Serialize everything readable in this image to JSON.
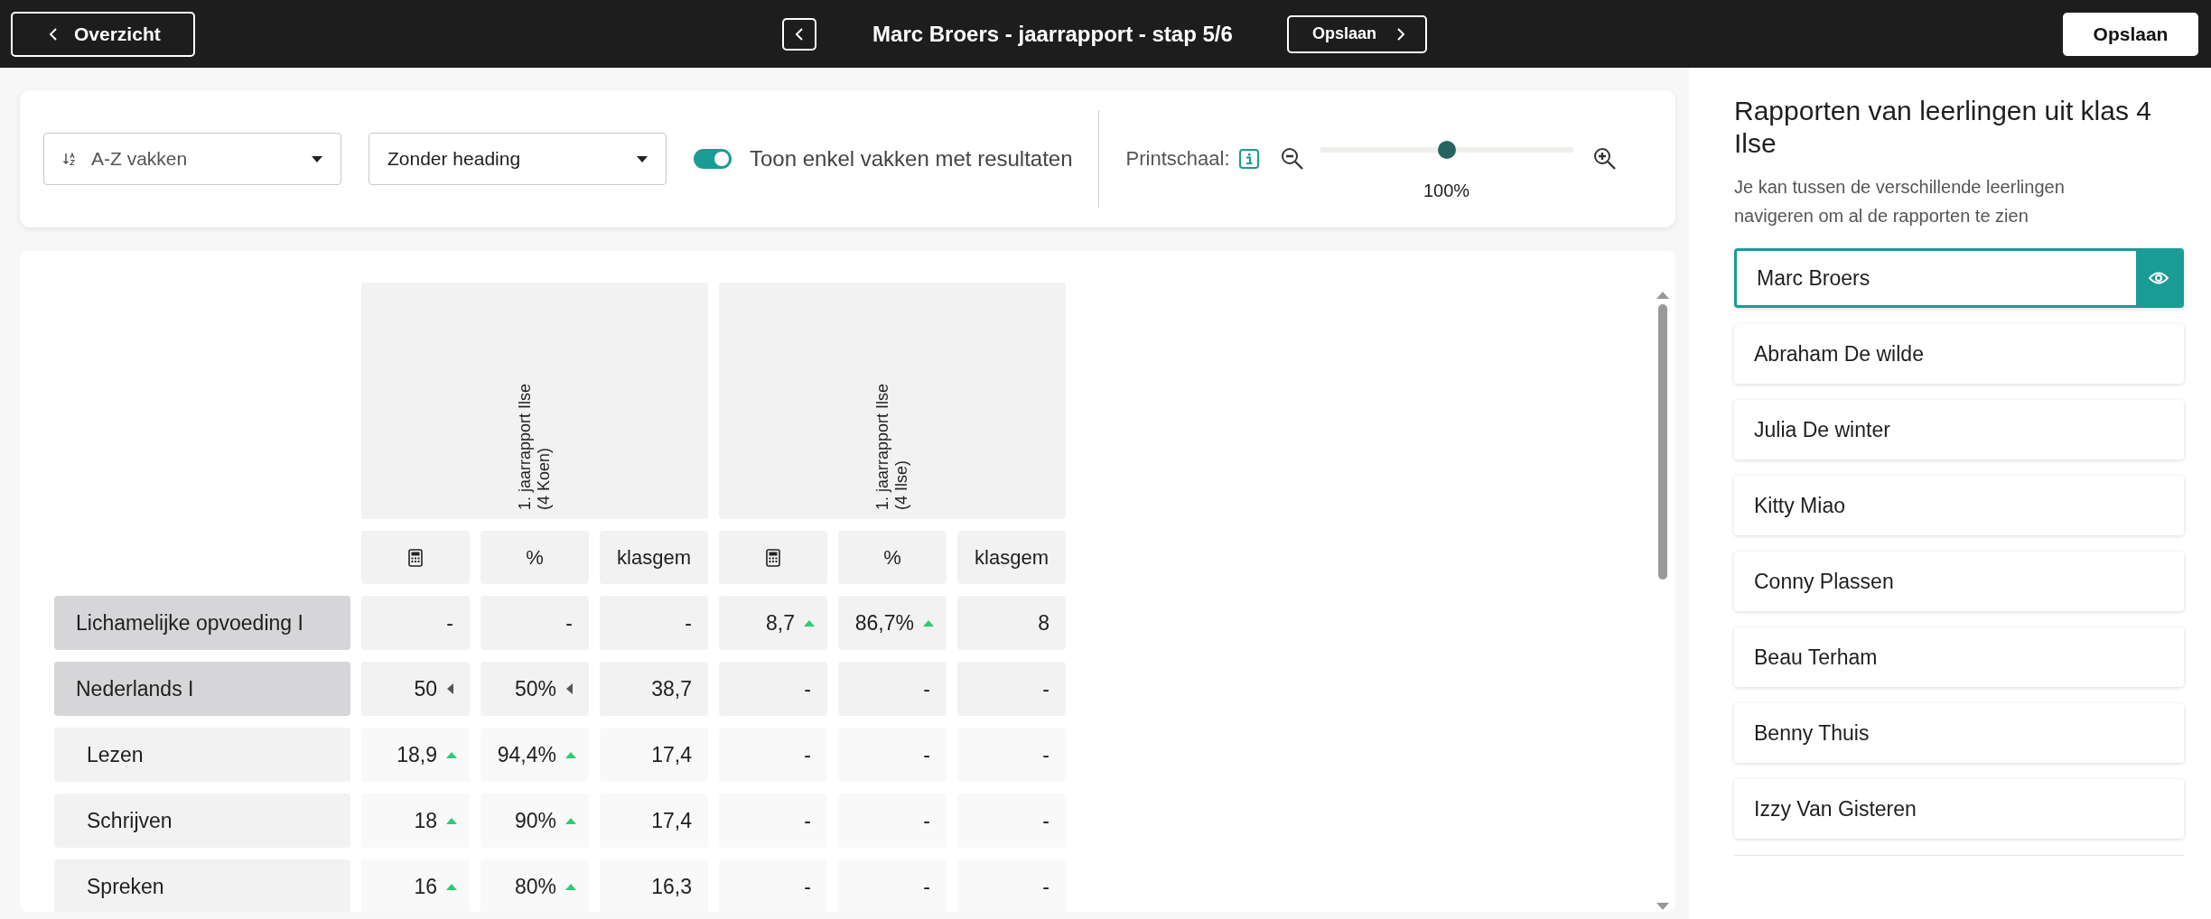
{
  "top_bar": {
    "back_button": "Overzicht",
    "title": "Marc Broers - jaarrapport - stap 5/6",
    "next_button": "Opslaan",
    "save_button": "Opslaan"
  },
  "toolbar": {
    "sort_select": "A-Z vakken",
    "heading_select": "Zonder heading",
    "toggle": {
      "label": "Toon enkel vakken met resultaten",
      "on": true
    },
    "print_scale": {
      "label": "Printschaal:",
      "level": 0.5,
      "reading": "100%"
    }
  },
  "table": {
    "groups": [
      {
        "title": "1. jaarrapport Ilse (4 Koen)",
        "columns": [
          {
            "kind": "icon"
          },
          {
            "kind": "text",
            "label": "%"
          },
          {
            "kind": "text",
            "label": "klasgem"
          }
        ]
      },
      {
        "title": "1. jaarrapport Ilse (4 Ilse)",
        "columns": [
          {
            "kind": "icon"
          },
          {
            "kind": "text",
            "label": "%"
          },
          {
            "kind": "text",
            "label": "klasgem"
          }
        ]
      }
    ],
    "rows": [
      {
        "label": "Lichamelijke opvoeding I",
        "kind": "main",
        "cells": [
          {
            "text": "-",
            "kind": "plain"
          },
          {
            "text": "-",
            "kind": "plain"
          },
          {
            "text": "-",
            "kind": "plain"
          },
          {
            "text": "8,7",
            "kind": "up"
          },
          {
            "text": "86,7%",
            "kind": "up"
          },
          {
            "text": "8",
            "kind": "plain"
          }
        ]
      },
      {
        "label": "Nederlands I",
        "kind": "main",
        "cells": [
          {
            "text": "50",
            "kind": "left"
          },
          {
            "text": "50%",
            "kind": "left"
          },
          {
            "text": "38,7",
            "kind": "plain"
          },
          {
            "text": "-",
            "kind": "plain"
          },
          {
            "text": "-",
            "kind": "plain"
          },
          {
            "text": "-",
            "kind": "plain"
          }
        ]
      },
      {
        "label": "Lezen",
        "kind": "sub",
        "cells": [
          {
            "text": "18,9",
            "kind": "up"
          },
          {
            "text": "94,4%",
            "kind": "up"
          },
          {
            "text": "17,4",
            "kind": "plain"
          },
          {
            "text": "-",
            "kind": "plain"
          },
          {
            "text": "-",
            "kind": "plain"
          },
          {
            "text": "-",
            "kind": "plain"
          }
        ]
      },
      {
        "label": "Schrijven",
        "kind": "sub",
        "cells": [
          {
            "text": "18",
            "kind": "up"
          },
          {
            "text": "90%",
            "kind": "up"
          },
          {
            "text": "17,4",
            "kind": "plain"
          },
          {
            "text": "-",
            "kind": "plain"
          },
          {
            "text": "-",
            "kind": "plain"
          },
          {
            "text": "-",
            "kind": "plain"
          }
        ]
      },
      {
        "label": "Spreken",
        "kind": "sub",
        "cells": [
          {
            "text": "16",
            "kind": "up"
          },
          {
            "text": "80%",
            "kind": "up"
          },
          {
            "text": "16,3",
            "kind": "plain"
          },
          {
            "text": "-",
            "kind": "plain"
          },
          {
            "text": "-",
            "kind": "plain"
          },
          {
            "text": "-",
            "kind": "plain"
          }
        ]
      }
    ]
  },
  "sidebar": {
    "title": "Rapporten van leerlingen uit klas 4 Ilse",
    "subtitle": "Je kan tussen de verschillende leerlingen navigeren om al de rapporten te zien",
    "students": [
      {
        "name": "Marc Broers",
        "selected": true
      },
      {
        "name": "Abraham De wilde",
        "selected": false
      },
      {
        "name": "Julia De winter",
        "selected": false
      },
      {
        "name": "Kitty Miao",
        "selected": false
      },
      {
        "name": "Conny Plassen",
        "selected": false
      },
      {
        "name": "Beau Terham",
        "selected": false
      },
      {
        "name": "Benny Thuis",
        "selected": false
      },
      {
        "name": "Izzy Van Gisteren",
        "selected": false
      }
    ]
  }
}
